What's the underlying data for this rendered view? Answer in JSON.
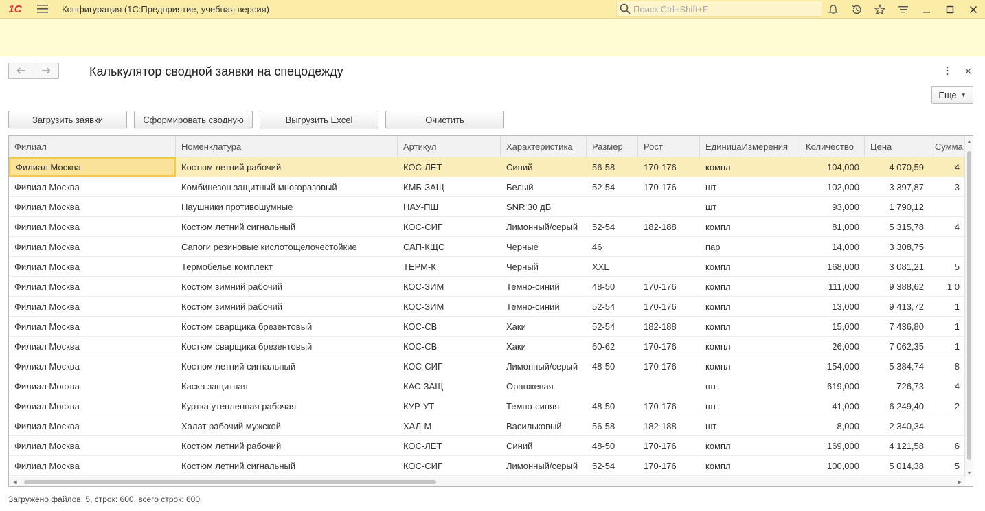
{
  "app": {
    "logo": "1С",
    "title": "Конфигурация  (1С:Предприятие, учебная версия)",
    "search_placeholder": "Поиск Ctrl+Shift+F",
    "icons": [
      "bell-icon",
      "history-icon",
      "star-icon",
      "settings-lines-icon",
      "minimize-icon",
      "maximize-icon",
      "close-icon"
    ]
  },
  "form": {
    "title": "Калькулятор сводной заявки на спецодежду",
    "more_label": "Еще"
  },
  "commands": {
    "load": "Загрузить заявки",
    "build": "Сформировать сводную",
    "export": "Выгрузить Excel",
    "clear": "Очистить"
  },
  "table": {
    "columns": [
      "Филиал",
      "Номенклатура",
      "Артикул",
      "Характеристика",
      "Размер",
      "Рост",
      "ЕдиницаИзмерения",
      "Количество",
      "Цена",
      "Сумма"
    ],
    "rows": [
      [
        "Филиал Москва",
        "Костюм летний рабочий",
        "КОС-ЛЕТ",
        "Синий",
        "56-58",
        "170-176",
        "компл",
        "104,000",
        "4 070,59",
        "4"
      ],
      [
        "Филиал Москва",
        "Комбинезон защитный многоразовый",
        "КМБ-ЗАЩ",
        "Белый",
        "52-54",
        "170-176",
        "шт",
        "102,000",
        "3 397,87",
        "3"
      ],
      [
        "Филиал Москва",
        "Наушники противошумные",
        "НАУ-ПШ",
        "SNR 30 дБ",
        "",
        "",
        "шт",
        "93,000",
        "1 790,12",
        ""
      ],
      [
        "Филиал Москва",
        "Костюм летний сигнальный",
        "КОС-СИГ",
        "Лимонный/серый",
        "52-54",
        "182-188",
        "компл",
        "81,000",
        "5 315,78",
        "4"
      ],
      [
        "Филиал Москва",
        "Сапоги резиновые кислотощелочестойкие",
        "САП-КЩС",
        "Черные",
        "46",
        "",
        "пар",
        "14,000",
        "3 308,75",
        ""
      ],
      [
        "Филиал Москва",
        "Термобелье комплект",
        "ТЕРМ-К",
        "Черный",
        "XXL",
        "",
        "компл",
        "168,000",
        "3 081,21",
        "5"
      ],
      [
        "Филиал Москва",
        "Костюм зимний рабочий",
        "КОС-ЗИМ",
        "Темно-синий",
        "48-50",
        "170-176",
        "компл",
        "111,000",
        "9 388,62",
        "1 0"
      ],
      [
        "Филиал Москва",
        "Костюм зимний рабочий",
        "КОС-ЗИМ",
        "Темно-синий",
        "52-54",
        "170-176",
        "компл",
        "13,000",
        "9 413,72",
        "1"
      ],
      [
        "Филиал Москва",
        "Костюм сварщика брезентовый",
        "КОС-СВ",
        "Хаки",
        "52-54",
        "182-188",
        "компл",
        "15,000",
        "7 436,80",
        "1"
      ],
      [
        "Филиал Москва",
        "Костюм сварщика брезентовый",
        "КОС-СВ",
        "Хаки",
        "60-62",
        "170-176",
        "компл",
        "26,000",
        "7 062,35",
        "1"
      ],
      [
        "Филиал Москва",
        "Костюм летний сигнальный",
        "КОС-СИГ",
        "Лимонный/серый",
        "48-50",
        "170-176",
        "компл",
        "154,000",
        "5 384,74",
        "8"
      ],
      [
        "Филиал Москва",
        "Каска защитная",
        "КАС-ЗАЩ",
        "Оранжевая",
        "",
        "",
        "шт",
        "619,000",
        "726,73",
        "4"
      ],
      [
        "Филиал Москва",
        "Куртка утепленная рабочая",
        "КУР-УТ",
        "Темно-синяя",
        "48-50",
        "170-176",
        "шт",
        "41,000",
        "6 249,40",
        "2"
      ],
      [
        "Филиал Москва",
        "Халат рабочий мужской",
        "ХАЛ-М",
        "Васильковый",
        "56-58",
        "182-188",
        "шт",
        "8,000",
        "2 340,34",
        ""
      ],
      [
        "Филиал Москва",
        "Костюм летний рабочий",
        "КОС-ЛЕТ",
        "Синий",
        "48-50",
        "170-176",
        "компл",
        "169,000",
        "4 121,58",
        "6"
      ],
      [
        "Филиал Москва",
        "Костюм летний сигнальный",
        "КОС-СИГ",
        "Лимонный/серый",
        "52-54",
        "170-176",
        "компл",
        "100,000",
        "5 014,38",
        "5"
      ]
    ]
  },
  "status": "Загружено файлов: 5, строк: 600, всего строк: 600"
}
